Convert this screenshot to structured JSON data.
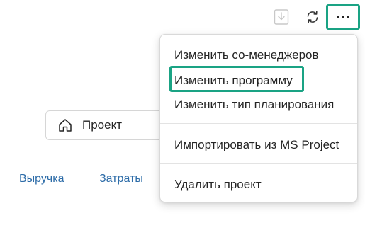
{
  "toolbar": {
    "import_icon": "download-box-icon",
    "refresh_icon": "refresh-icon",
    "more_icon": "more-horizontal-icon",
    "highlight_color": "#1aa384"
  },
  "project": {
    "icon": "home-icon",
    "label": "Проект"
  },
  "tabs": [
    {
      "label": "Выручка"
    },
    {
      "label": "Затраты"
    }
  ],
  "menu": {
    "items": [
      {
        "label": "Изменить со-менеджеров"
      },
      {
        "label": "Изменить программу",
        "highlighted": true
      },
      {
        "label": "Изменить тип планирования"
      },
      {
        "label": "Импортировать из MS Project"
      },
      {
        "label": "Удалить проект"
      }
    ]
  },
  "colors": {
    "link": "#2d6ca8",
    "highlight": "#1aa384"
  }
}
